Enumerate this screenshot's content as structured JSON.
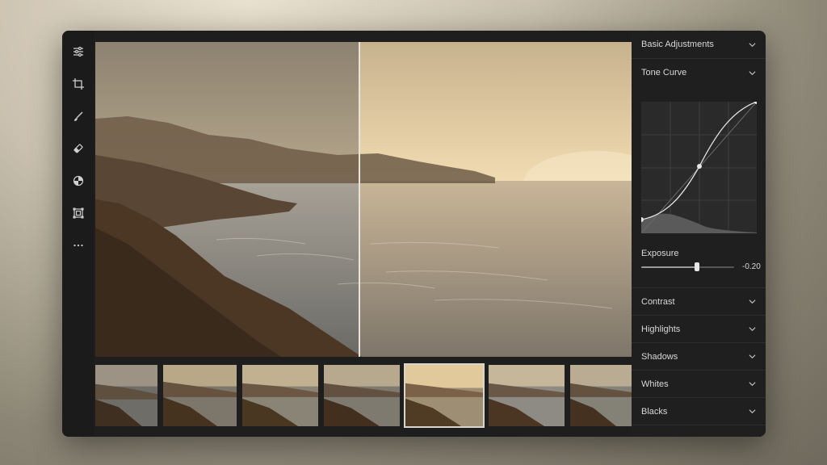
{
  "toolbar": {
    "tools": [
      {
        "name": "adjust-sliders-icon"
      },
      {
        "name": "crop-icon"
      },
      {
        "name": "brush-icon"
      },
      {
        "name": "eraser-icon"
      },
      {
        "name": "color-wheel-icon"
      },
      {
        "name": "transform-icon"
      },
      {
        "name": "more-icon"
      }
    ]
  },
  "panel": {
    "basic_adjustments": "Basic Adjustments",
    "tone_curve": "Tone Curve",
    "exposure_label": "Exposure",
    "exposure_value": "-0.20",
    "exposure_fraction": 0.6,
    "sections": [
      "Contrast",
      "Highlights",
      "Shadows",
      "Whites",
      "Blacks"
    ]
  },
  "colors": {
    "panel_bg": "#1f1f20",
    "toolbar_bg": "#1b1b1c",
    "selected_thumb_border": "#d9d5cd"
  }
}
